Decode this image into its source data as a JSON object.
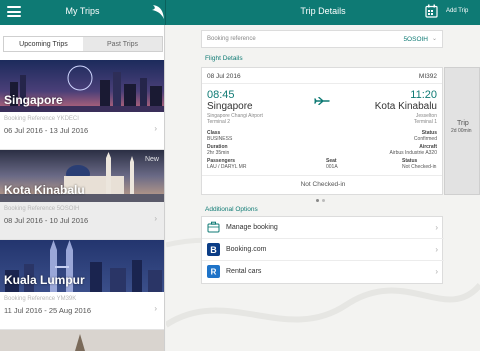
{
  "header": {
    "left_title": "My Trips",
    "right_title": "Trip Details",
    "add_trip": "Add Trip"
  },
  "tabs": {
    "upcoming": "Upcoming Trips",
    "past": "Past Trips"
  },
  "trips": [
    {
      "city": "Singapore",
      "ref": "Booking Reference YKDECI",
      "dates": "06 Jul 2016 - 13 Jul 2016"
    },
    {
      "city": "Kota Kinabalu",
      "ref": "Booking Reference 5OSOIH",
      "dates": "08 Jul 2016 - 10 Jul 2016",
      "badge": "New"
    },
    {
      "city": "Kuala Lumpur",
      "ref": "Booking Reference YM39K",
      "dates": "11 Jul 2016 - 25 Aug 2016"
    }
  ],
  "booking": {
    "label": "Booking reference",
    "value": "5OSOIH"
  },
  "flight_details_title": "Flight Details",
  "flight": {
    "date": "08 Jul 2016",
    "number": "MI392",
    "dep_time": "08:45",
    "arr_time": "11:20",
    "dep_city": "Singapore",
    "arr_city": "Kota Kinabalu",
    "dep_airport": "Singapore Changi Airport",
    "arr_airport": "Jesselton",
    "dep_terminal": "Terminal 2",
    "arr_terminal": "Terminal 1",
    "class_label": "Class",
    "class_value": "BUSINESS",
    "status_label": "Status",
    "status_value": "Confirmed",
    "duration_label": "Duration",
    "duration_value": "2hr 35min",
    "aircraft_label": "Aircraft",
    "aircraft_value": "Airbus Industrie A320",
    "passengers_label": "Passengers",
    "passengers_value": "LAU / DARYL MR",
    "seat_label": "Seat",
    "seat_value": "001A",
    "status2_label": "Status",
    "status2_value": "Not Checked-in",
    "checkin": "Not Checked-in"
  },
  "peek": {
    "title": "Trip",
    "duration": "2d 00min"
  },
  "additional_options_title": "Additional Options",
  "options": [
    {
      "label": "Manage booking",
      "icon": "suitcase-icon"
    },
    {
      "label": "Booking.com",
      "icon": "booking-b-icon"
    },
    {
      "label": "Rental cars",
      "icon": "rental-car-icon"
    }
  ],
  "colors": {
    "brand": "#0e7a74",
    "booking_blue": "#0b3d86",
    "rental_blue": "#1e73c8"
  }
}
